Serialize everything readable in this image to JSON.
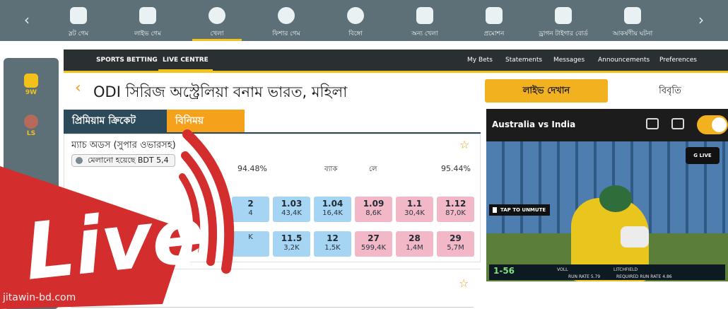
{
  "nav": {
    "items": [
      {
        "label": "স্লট গেম",
        "icon": "slot-icon"
      },
      {
        "label": "লাইভ গেম",
        "icon": "live-game-icon"
      },
      {
        "label": "খেলা",
        "icon": "cricket-ball-icon",
        "active": true
      },
      {
        "label": "ফিশার গেম",
        "icon": "crosshair-icon"
      },
      {
        "label": "বিঙ্গো",
        "icon": "bingo-ball-icon"
      },
      {
        "label": "অন্য খেলা",
        "icon": "rocket-icon"
      },
      {
        "label": "প্রমোশন",
        "icon": "gift-icon"
      },
      {
        "label": "ড্রাগন টাইগার বোর্ড",
        "icon": "dragon-icon"
      },
      {
        "label": "আকর্ষণীয় ঘটনা",
        "icon": "party-popper-icon"
      }
    ]
  },
  "sidebar": {
    "items": [
      {
        "label": "9W"
      },
      {
        "label": "LS"
      }
    ]
  },
  "subnav": {
    "sports_betting": "SPORTS BETTING",
    "live_centre": "LIVE CENTRE",
    "my_bets": "My Bets",
    "statements": "Statements",
    "messages": "Messages",
    "announcements": "Announcements",
    "preferences": "Preferences"
  },
  "match": {
    "title": "ODI সিরিজ অস্ট্রেলিয়া বনাম ভারত, মহিলা"
  },
  "market_tabs": {
    "premium": "প্রিমিয়াম ক্রিকেট",
    "exchange": "বিনিময়"
  },
  "market": {
    "title": "ম্যাচ অডস (সুপার ওভারসহ)",
    "matched": "মেলানো হয়েছে BDT 5,4",
    "back_pct": "94.48%",
    "back_label": "ব্যাক",
    "lay_label": "লে",
    "lay_pct": "95.44%",
    "rows": [
      {
        "back": [
          {
            "odds": "2",
            "vol": "4"
          },
          {
            "odds": "1.03",
            "vol": "43,4K"
          },
          {
            "odds": "1.04",
            "vol": "16,4K"
          }
        ],
        "lay": [
          {
            "odds": "1.09",
            "vol": "8,6K"
          },
          {
            "odds": "1.1",
            "vol": "30,4K"
          },
          {
            "odds": "1.12",
            "vol": "87,0K"
          }
        ]
      },
      {
        "back": [
          {
            "odds": "",
            "vol": "K"
          },
          {
            "odds": "11.5",
            "vol": "3,2K"
          },
          {
            "odds": "12",
            "vol": "1,5K"
          }
        ],
        "lay": [
          {
            "odds": "27",
            "vol": "599,4K"
          },
          {
            "odds": "28",
            "vol": "1,4M"
          },
          {
            "odds": "29",
            "vol": "5,7M"
          }
        ]
      }
    ]
  },
  "right_panel": {
    "live_view": "লাইভ দেখান",
    "stats": "বিবৃতি",
    "video_title": "Australia vs India",
    "unmute": "TAP TO UNMUTE",
    "glive": "G LIVE",
    "score": "1-56",
    "batter1": "VOLL",
    "batter2": "LITCHFIELD",
    "run_rate": "RUN RATE 5.79",
    "required": "REQUIRED RUN RATE 4.86"
  },
  "overlay": {
    "live_text": "Live",
    "watermark": "jitawin-bd.com"
  },
  "colors": {
    "nav_bg": "#5d7077",
    "accent_yellow": "#f2b11f",
    "back_blue": "#a6d5f4",
    "lay_pink": "#f3b8c8",
    "live_red": "#d32d2d"
  }
}
